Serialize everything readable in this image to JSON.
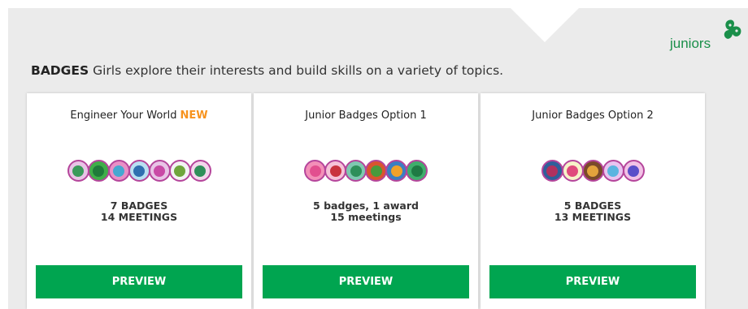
{
  "logo": {
    "text": "juniors",
    "icon": "trefoil-icon",
    "color": "#1a8f4a"
  },
  "intro": {
    "heading": "BADGES",
    "text": "Girls explore their interests and build skills on a variety of topics."
  },
  "colors": {
    "accent": "#00a550",
    "new": "#f7931e",
    "badge_ring": "#b5459b"
  },
  "cards": [
    {
      "title": "Engineer Your World",
      "new_label": "NEW",
      "stats_line1": "7 BADGES",
      "stats_line2": "14 MEETINGS",
      "button": "PREVIEW",
      "badges": [
        {
          "icon": "flower-badge-icon",
          "fill": "#e8c4e6",
          "inner": "#3a9a5b"
        },
        {
          "icon": "tree-badge-icon",
          "fill": "#3fae49",
          "inner": "#1f7a3a"
        },
        {
          "icon": "wave-badge-icon",
          "fill": "#e98fc6",
          "inner": "#45a7d1"
        },
        {
          "icon": "bridge-badge-icon",
          "fill": "#b9e0f2",
          "inner": "#2f6fb0"
        },
        {
          "icon": "flower-outline-badge-icon",
          "fill": "#e8c4e6",
          "inner": "#c94aa6"
        },
        {
          "icon": "pendulum-badge-icon",
          "fill": "#f3f3f3",
          "inner": "#6fa63c"
        },
        {
          "icon": "recycle-badge-icon",
          "fill": "#f3d7ec",
          "inner": "#2f8f5a"
        }
      ]
    },
    {
      "title": "Junior Badges Option 1",
      "new_label": "",
      "stats_line1": "5 badges, 1 award",
      "stats_line2": "15 meetings",
      "button": "PREVIEW",
      "badges": [
        {
          "icon": "pig-badge-icon",
          "fill": "#f38fb8",
          "inner": "#e24f8f"
        },
        {
          "icon": "ball-badge-icon",
          "fill": "#f6c2d8",
          "inner": "#c9333e"
        },
        {
          "icon": "tent-badge-icon",
          "fill": "#7ec8b0",
          "inner": "#2e8f5a"
        },
        {
          "icon": "sign-badge-icon",
          "fill": "#d9552f",
          "inner": "#4a9a3c"
        },
        {
          "icon": "book-badge-icon",
          "fill": "#3b7fc2",
          "inner": "#f0a12a"
        },
        {
          "icon": "take-action-badge-icon",
          "fill": "#3fae6c",
          "inner": "#1f7a44"
        }
      ]
    },
    {
      "title": "Junior Badges Option 2",
      "new_label": "",
      "stats_line1": "5 BADGES",
      "stats_line2": "13 MEETINGS",
      "button": "PREVIEW",
      "badges": [
        {
          "icon": "bird-badge-icon",
          "fill": "#2f5f9a",
          "inner": "#b0315f"
        },
        {
          "icon": "paint-badge-icon",
          "fill": "#f7f2c9",
          "inner": "#e04a7d"
        },
        {
          "icon": "food-badge-icon",
          "fill": "#7a4a2a",
          "inner": "#e3a33c"
        },
        {
          "icon": "balloon-badge-icon",
          "fill": "#e9c4f0",
          "inner": "#5bb4e0"
        },
        {
          "icon": "bowtie-badge-icon",
          "fill": "#f2c2e6",
          "inner": "#5a4fc9"
        }
      ]
    }
  ]
}
